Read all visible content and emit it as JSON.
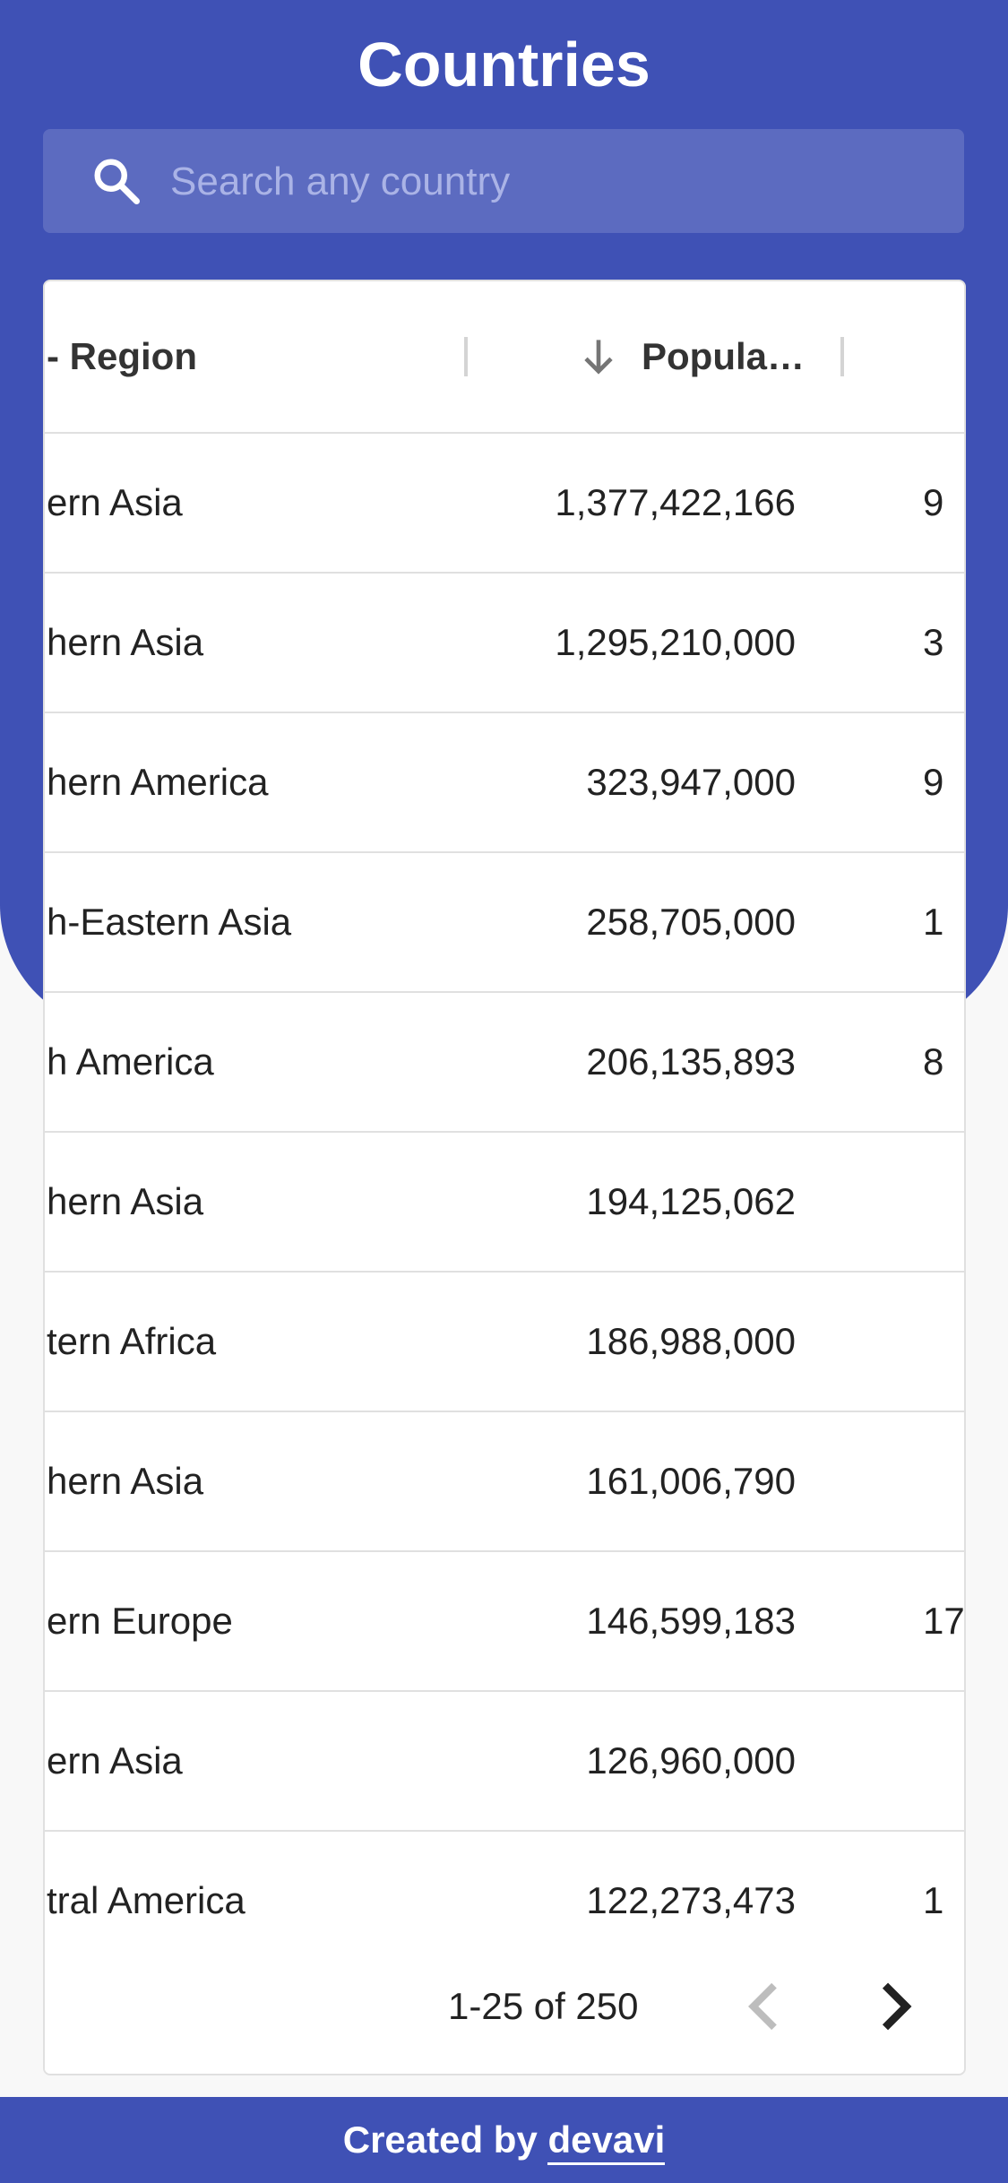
{
  "header": {
    "title": "Countries",
    "search_placeholder": "Search any country"
  },
  "table": {
    "columns": {
      "region": "- Region",
      "population": "Popula…"
    },
    "sort": {
      "column": "population",
      "direction": "descending"
    },
    "rows": [
      {
        "region": "ern Asia",
        "population": "1,377,422,166",
        "extra": "9"
      },
      {
        "region": "hern Asia",
        "population": "1,295,210,000",
        "extra": "3"
      },
      {
        "region": "hern America",
        "population": "323,947,000",
        "extra": "9"
      },
      {
        "region": "h-Eastern Asia",
        "population": "258,705,000",
        "extra": "1"
      },
      {
        "region": "h America",
        "population": "206,135,893",
        "extra": "8"
      },
      {
        "region": "hern Asia",
        "population": "194,125,062",
        "extra": ""
      },
      {
        "region": "tern Africa",
        "population": "186,988,000",
        "extra": ""
      },
      {
        "region": "hern Asia",
        "population": "161,006,790",
        "extra": ""
      },
      {
        "region": "ern Europe",
        "population": "146,599,183",
        "extra": "17"
      },
      {
        "region": "ern Asia",
        "population": "126,960,000",
        "extra": ""
      },
      {
        "region": "tral America",
        "population": "122,273,473",
        "extra": "1"
      }
    ]
  },
  "pagination": {
    "range": "1-25 of 250"
  },
  "footer": {
    "prefix": "Created by ",
    "link": "devavi"
  },
  "colors": {
    "primary": "#3f51b5",
    "search_bg": "#5c6bc0",
    "background": "#f8f8f8"
  },
  "icons": {
    "search": "search-icon",
    "sort": "arrow-down-icon",
    "prev": "chevron-left-icon",
    "next": "chevron-right-icon"
  }
}
